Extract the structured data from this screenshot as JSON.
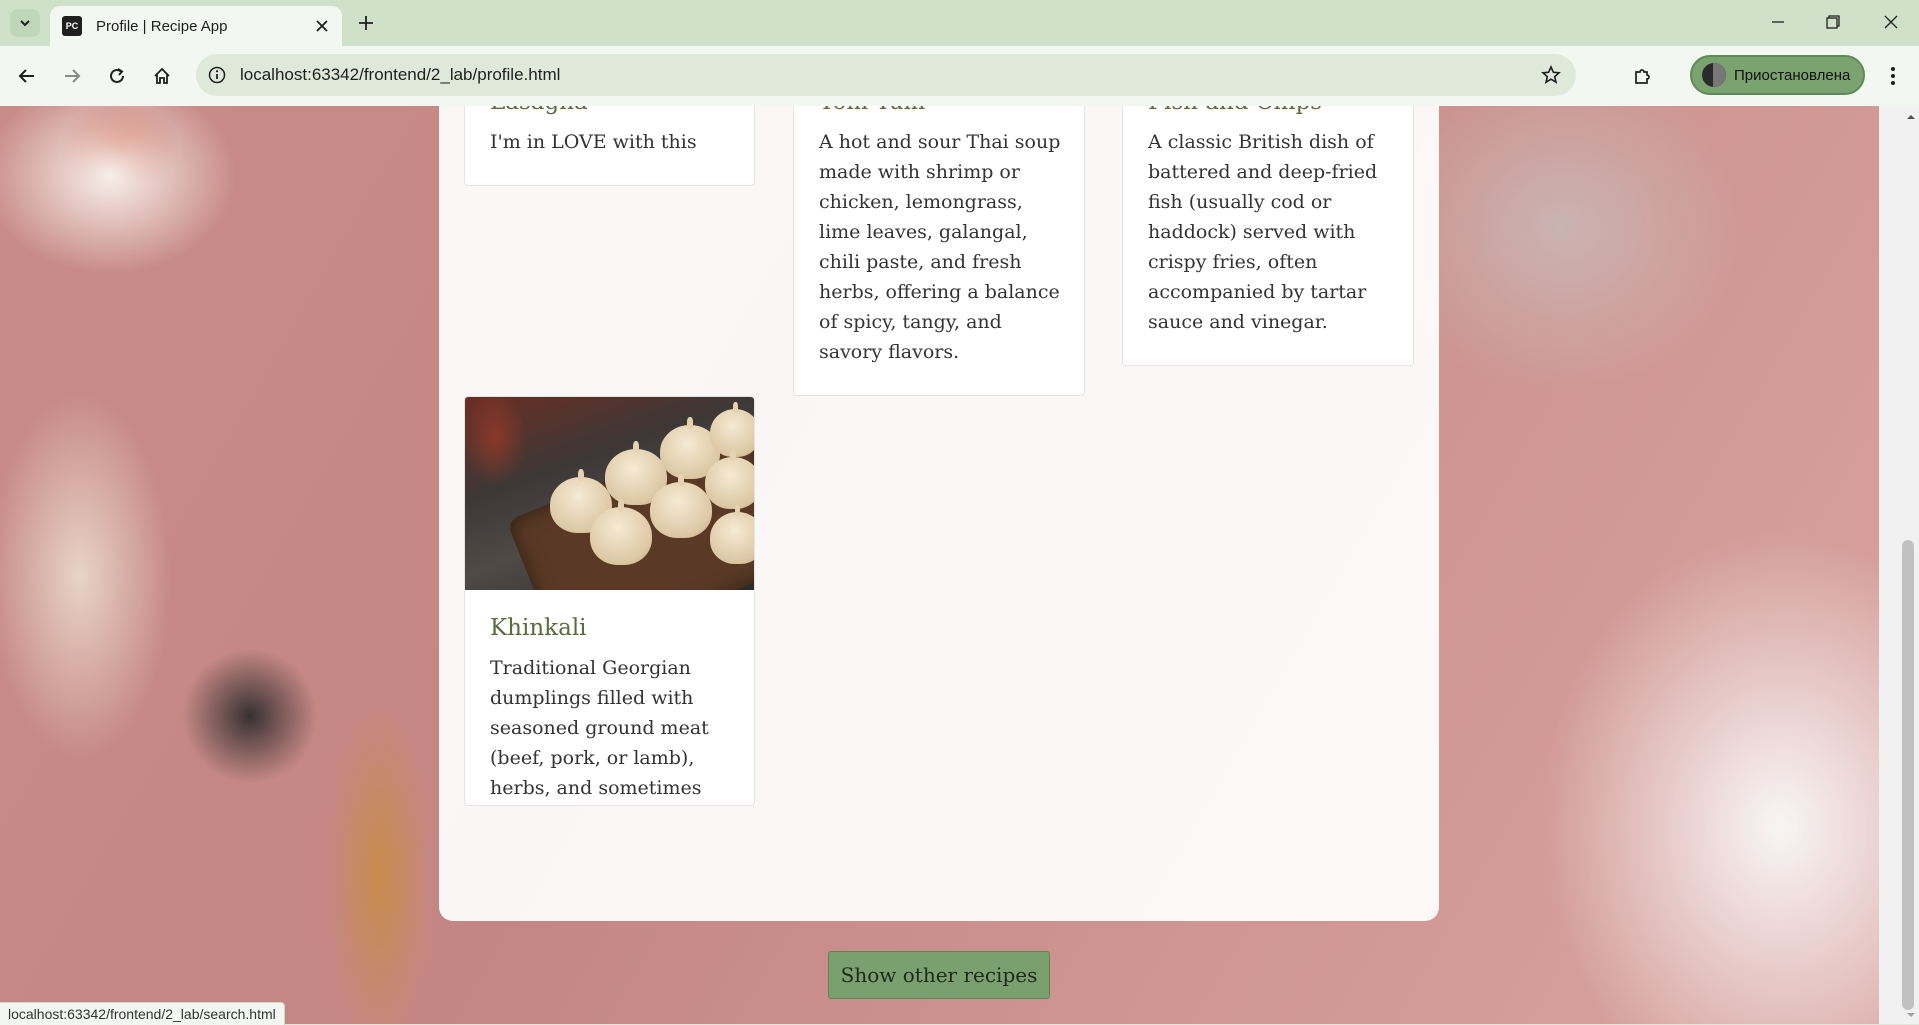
{
  "browser": {
    "tab_title": "Profile | Recipe App",
    "favicon_text": "PC",
    "url": "localhost:63342/frontend/2_lab/profile.html",
    "profile_label": "Приостановлена",
    "status_url": "localhost:63342/frontend/2_lab/search.html"
  },
  "cards": [
    {
      "title": "Lasagna",
      "description": "I'm in LOVE with this"
    },
    {
      "title": "Tom Yum",
      "description": "A hot and sour Thai soup made with shrimp or chicken, lemongrass, lime leaves, galangal, chili paste, and fresh herbs, offering a balance of spicy, tangy, and savory flavors."
    },
    {
      "title": "Fish and Chips",
      "description": "A classic British dish of battered and deep-fried fish (usually cod or haddock) served with crispy fries, often accompanied by tartar sauce and vinegar."
    },
    {
      "title": "Khinkali",
      "description": "Traditional Georgian dumplings filled with seasoned ground meat (beef, pork, or lamb), herbs, and sometimes broth, boiled and served hot, eaten by hand.",
      "image": "khinkali-photo"
    }
  ],
  "show_other_button": "Show other recipes",
  "colors": {
    "accent_button": "#7aa070",
    "card_title": "#5a6b3c",
    "chrome_tabstrip": "#cfe2c9",
    "profile_chip": "#7aa36f"
  }
}
